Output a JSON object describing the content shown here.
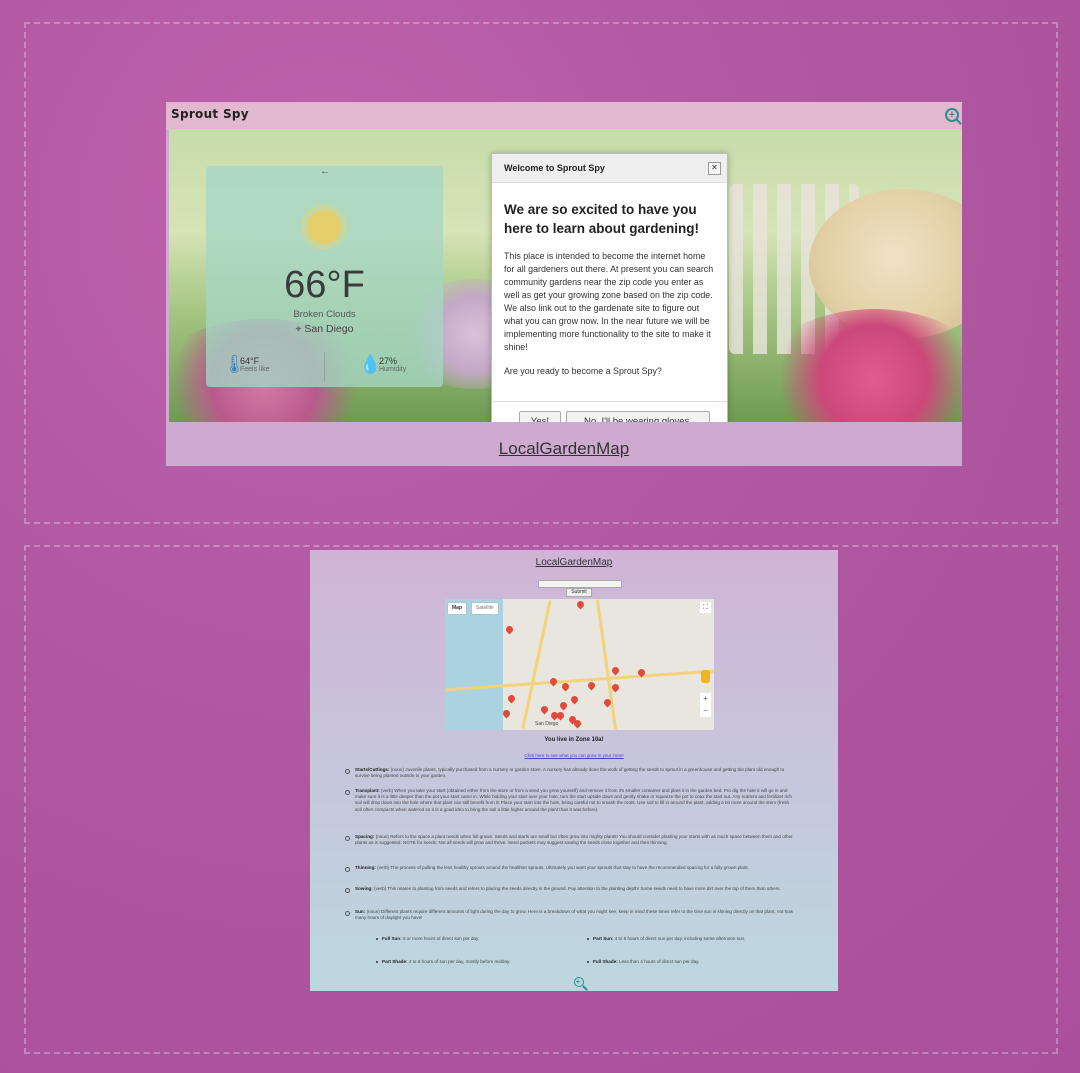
{
  "brand": "Sprout Spy",
  "weather": {
    "temp": "66°F",
    "condition": "Broken Clouds",
    "city": "San Diego",
    "feels_value": "64°F",
    "feels_label": "Feels like",
    "humidity_value": "27%",
    "humidity_label": "Humidity"
  },
  "modal": {
    "title": "Welcome to Sprout Spy",
    "heading": "We are so excited to have you here to learn about gardening!",
    "body": "This place is intended to become the internet home for all gardeners out there. At present you can search community gardens near the zip code you enter as well as get your growing zone based on the zip code. We also link out to the gardenate site to figure out what you can grow now. In the near future we will be implementing more functionality to the site to make it shine!",
    "question": "Are you ready to become a Sprout Spy?",
    "yes_label": "Yes!",
    "no_label": "No, I'll be wearing gloves."
  },
  "map_link": "LocalGardenMap",
  "page2": {
    "map_link": "LocalGardenMap",
    "submit_label": "Submit",
    "map_tab_map": "Map",
    "map_tab_satellite": "Satellite",
    "map_city_label": "San Diego",
    "zone_text": "You live in Zone 10a!",
    "zone_link": "Click here to see what you can grow in your zone!",
    "glossary": [
      {
        "term": "Starts/Cuttings:",
        "text": "(noun) Juvenile plants, typically purchased from a nursery or garden store. A nursery has already done the work of getting the seeds to sprout in a greenhouse and getting the plant old enough to survive being planted outside in your garden."
      },
      {
        "term": "Transplant:",
        "text": "(verb) When you take your start (obtained either from the store or from a seed you grew yourself) and remove it from it's smaller container and plant it in the garden bed. Pro dig the hole it will go in and make sure it is a little deeper than the pot your start came in. While holding your start over your hole, turn the start upside down and gently shake or squeeze the pot to coax the start out. Any nutrient and fertilizer rich soil will drop down into the hole where that plant can still benefit from it! Place your start into the hole, being careful not to smash the roots. Use soil to fill in around the plant, adding a bit more around the stem (fresh soil often compacts when watered so it is a good idea to bring the soil a little higher around the plant than it was before)."
      },
      {
        "term": "Spacing:",
        "text": "(noun) Refers to the space a plant needs when full grown. Seeds and starts are small but often grow into mighty plants! You should consider planting your starts with as much space between them and other plants as is suggested. NOTE for seeds: Not all seeds will grow and thrive. Seed packets may suggest sowing the seeds close together and then thinning."
      },
      {
        "term": "Thinning:",
        "text": "(verb) The process of pulling the less healthy sprouts around the healthier sprouts. Ultimately you want your sprouts that stay to have the recommended spacing for a fully grown plant."
      },
      {
        "term": "Sowing:",
        "text": "(verb) This relates to planting from seeds and refers to placing the seeds directly in the ground. Pay attention to the planting depth! Some seeds need to have more dirt over the top of them than others."
      },
      {
        "term": "Sun:",
        "text": "(noun) Different plants require different amounts of light during the day to grow. Here is a breakdown of what you might see, keep in mind these times refer to the time sun is shining directly on that plant, not how many hours of daylight you have!"
      }
    ],
    "sun": [
      {
        "term": "Full Sun:",
        "text": "6 or more hours of direct sun per day."
      },
      {
        "term": "Part Sun:",
        "text": "4 to 6 hours of direct sun per day, including some afternoon sun."
      },
      {
        "term": "Part Shade:",
        "text": "4 to 6 hours of sun per day, mostly before midday."
      },
      {
        "term": "Full Shade:",
        "text": "Less than 4 hours of direct sun per day."
      }
    ]
  }
}
